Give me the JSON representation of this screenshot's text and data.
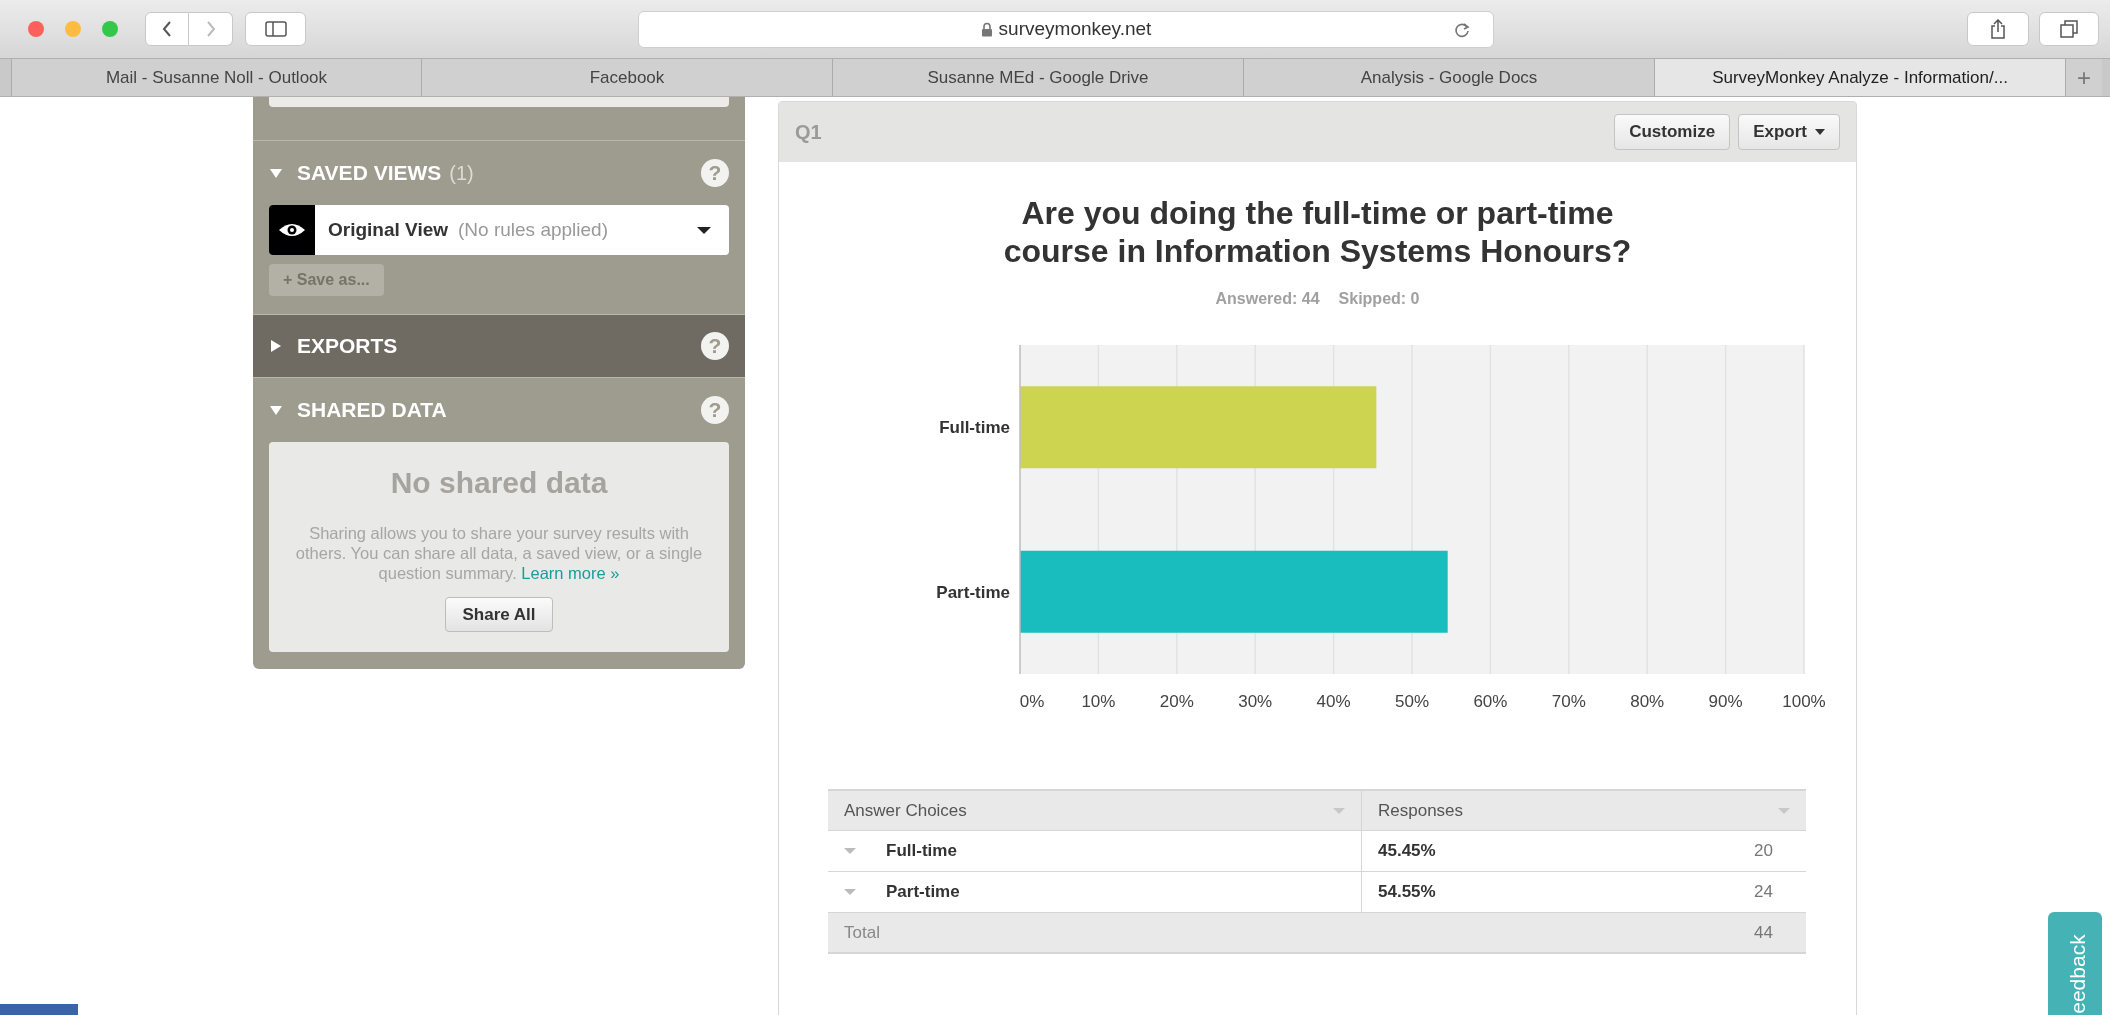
{
  "browser": {
    "url": "surveymonkey.net",
    "new_tab": "+",
    "tabs": [
      {
        "label": "Mail - Susanne Noll - Outlook",
        "selected": false
      },
      {
        "label": "Facebook",
        "selected": false
      },
      {
        "label": "Susanne MEd - Google Drive",
        "selected": false
      },
      {
        "label": "Analysis - Google Docs",
        "selected": false
      },
      {
        "label": "SurveyMonkey Analyze - Information/...",
        "selected": true
      }
    ]
  },
  "sidebar": {
    "sections": [
      {
        "kind": "views",
        "title": "SAVED VIEWS",
        "count": "(1)",
        "expanded": true,
        "help": "?",
        "view_name": "Original View",
        "view_note": "(No rules applied)",
        "save_button": "+ Save as..."
      },
      {
        "kind": "plain",
        "title": "EXPORTS",
        "expanded": false,
        "help": "?"
      },
      {
        "kind": "shared",
        "title": "SHARED DATA",
        "expanded": true,
        "help": "?",
        "empty_title": "No shared data",
        "description": "Sharing allows you to share your survey results with others. You can share all data, a saved view, or a single question summary.",
        "link": "Learn more »",
        "button": "Share All"
      }
    ]
  },
  "question": {
    "number": "Q1",
    "buttons": [
      {
        "label": "Customize",
        "dropdown": false
      },
      {
        "label": "Export",
        "dropdown": true
      }
    ],
    "title": "Are you doing the full-time or part-time course in Information Systems Honours?",
    "answered": "Answered: 44",
    "skipped": "Skipped: 0",
    "chart_data": {
      "type": "bar",
      "orientation": "horizontal",
      "grid": true,
      "categories": [
        "Full-time",
        "Part-time"
      ],
      "values": [
        45.45,
        54.55
      ],
      "xlim": [
        0,
        100
      ],
      "xticks": [
        {
          "value": 0,
          "label": "0%"
        },
        {
          "value": 10,
          "label": "10%"
        },
        {
          "value": 20,
          "label": "20%"
        },
        {
          "value": 30,
          "label": "30%"
        },
        {
          "value": 40,
          "label": "40%"
        },
        {
          "value": 50,
          "label": "50%"
        },
        {
          "value": 60,
          "label": "60%"
        },
        {
          "value": 70,
          "label": "70%"
        },
        {
          "value": 80,
          "label": "80%"
        },
        {
          "value": 90,
          "label": "90%"
        },
        {
          "value": 100,
          "label": "100%"
        }
      ]
    },
    "table": {
      "columns": [
        "Answer Choices",
        "Responses"
      ],
      "rows": [
        {
          "choice": "Full-time",
          "percent": "45.45%",
          "count": "20"
        },
        {
          "choice": "Part-time",
          "percent": "54.55%",
          "count": "24"
        }
      ],
      "total": {
        "label": "Total",
        "count": "44"
      }
    }
  },
  "feedback": "eedback"
}
